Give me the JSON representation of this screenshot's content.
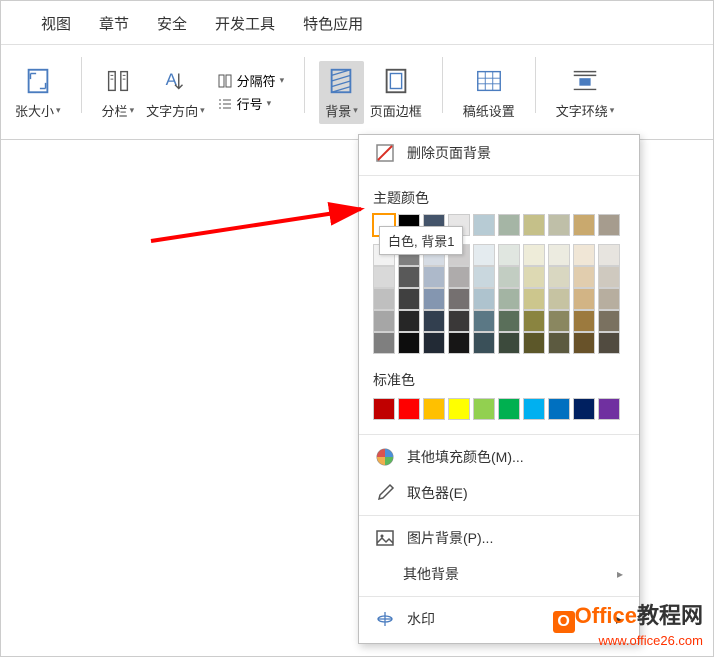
{
  "menubar": {
    "items": [
      "视图",
      "章节",
      "安全",
      "开发工具",
      "特色应用"
    ]
  },
  "ribbon": {
    "buttons": [
      {
        "label": "张大小",
        "caret": true,
        "icon": "page-size"
      },
      {
        "label": "分栏",
        "caret": true,
        "icon": "columns"
      },
      {
        "label": "文字方向",
        "caret": true,
        "icon": "text-direction"
      },
      {
        "label_top": "分隔符",
        "label_bottom": "行号",
        "icon": "separator",
        "split": true
      },
      {
        "label": "背景",
        "caret": true,
        "icon": "background",
        "active": true
      },
      {
        "label": "页面边框",
        "caret": false,
        "icon": "page-border"
      },
      {
        "label": "稿纸设置",
        "caret": false,
        "icon": "manuscript"
      },
      {
        "label": "文字环绕",
        "caret": true,
        "icon": "text-wrap"
      }
    ]
  },
  "dropdown": {
    "remove_bg": "删除页面背景",
    "theme_title": "主题颜色",
    "tooltip": "白色, 背景1",
    "theme_colors": [
      "#ffffff",
      "#000000",
      "#44546a",
      "#e7e6e6",
      "#b7cbd4",
      "#a5b5a5",
      "#c5c089",
      "#bfbfa8",
      "#c9a96e",
      "#a69c8e"
    ],
    "tints": [
      [
        "#f2f2f2",
        "#7f7f7f",
        "#d6dce4",
        "#cfcdcd",
        "#e4ebef",
        "#e0e6e0",
        "#eeecd9",
        "#ecebe0",
        "#f0e6d6",
        "#e7e4df"
      ],
      [
        "#d9d9d9",
        "#595959",
        "#adb9ca",
        "#aeabab",
        "#c9d7de",
        "#c2cdc2",
        "#ddd9b3",
        "#d9d7c1",
        "#e1cdae",
        "#cfc9bf"
      ],
      [
        "#bfbfbf",
        "#404040",
        "#8496b0",
        "#757070",
        "#aec3ce",
        "#a3b4a3",
        "#ccc68d",
        "#c6c3a2",
        "#d2b485",
        "#b7ae9f"
      ],
      [
        "#a6a6a6",
        "#262626",
        "#323f4f",
        "#3a3838",
        "#5b7885",
        "#5a6f5a",
        "#8a8440",
        "#8a8760",
        "#9c7a3e",
        "#7a7160"
      ],
      [
        "#7f7f7f",
        "#0d0d0d",
        "#222a35",
        "#171616",
        "#3a5059",
        "#3c4a3c",
        "#5c5729",
        "#5c5a40",
        "#685229",
        "#514b40"
      ]
    ],
    "standard_title": "标准色",
    "standard_colors": [
      "#c00000",
      "#ff0000",
      "#ffc000",
      "#ffff00",
      "#92d050",
      "#00b050",
      "#00b0f0",
      "#0070c0",
      "#002060",
      "#7030a0"
    ],
    "more_fill": "其他填充颜色(M)...",
    "picker": "取色器(E)",
    "picture_bg": "图片背景(P)...",
    "other_bg": "其他背景",
    "watermark_item": "水印"
  },
  "watermark": {
    "brand_office": "Office",
    "brand_cn": "教程网",
    "url": "www.office26.com"
  }
}
